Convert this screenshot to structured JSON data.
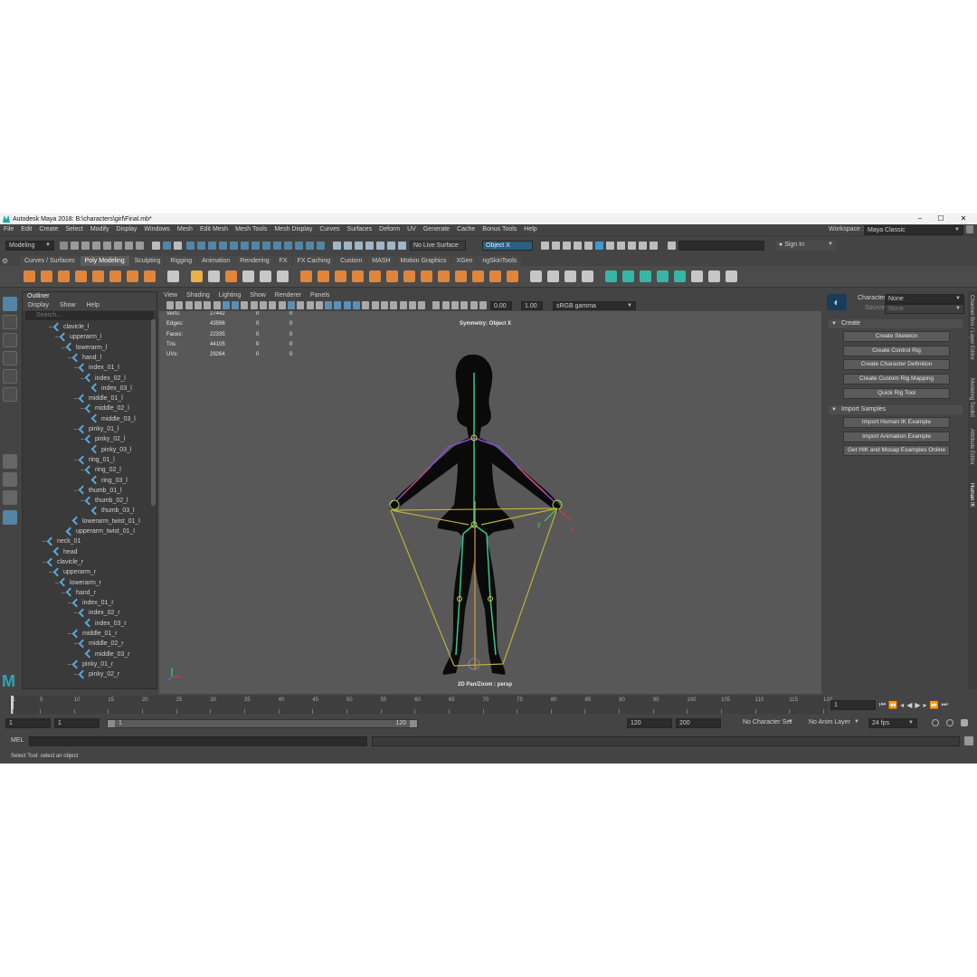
{
  "window": {
    "title": "Autodesk Maya 2018: B:\\characters\\girl\\Final.mb*",
    "minimize": "–",
    "maximize": "☐",
    "close": "✕"
  },
  "menubar": [
    "File",
    "Edit",
    "Create",
    "Select",
    "Modify",
    "Display",
    "Windows",
    "Mesh",
    "Edit Mesh",
    "Mesh Tools",
    "Mesh Display",
    "Curves",
    "Surfaces",
    "Deform",
    "UV",
    "Generate",
    "Cache",
    "Bonus Tools",
    "Help"
  ],
  "workspace": {
    "label": "Workspace :",
    "value": "Maya Classic"
  },
  "statusline": {
    "mode": "Modeling",
    "live_surface": "No Live Surface",
    "symmetry": "Object X",
    "sign_in": "Sign In"
  },
  "shelf_tabs": [
    "Curves / Surfaces",
    "Poly Modeling",
    "Sculpting",
    "Rigging",
    "Animation",
    "Rendering",
    "FX",
    "FX Caching",
    "Custom",
    "MASH",
    "Motion Graphics",
    "XGen",
    "ngSkinTools"
  ],
  "shelf_active": "Poly Modeling",
  "outliner": {
    "title": "Outliner",
    "menus": [
      "Display",
      "Show",
      "Help"
    ],
    "search_placeholder": "Search...",
    "items": [
      {
        "label": "clavicle_l",
        "depth": 4,
        "exp": "–"
      },
      {
        "label": "upperarm_l",
        "depth": 5,
        "exp": "–"
      },
      {
        "label": "lowerarm_l",
        "depth": 6,
        "exp": "–"
      },
      {
        "label": "hand_l",
        "depth": 7,
        "exp": "–"
      },
      {
        "label": "index_01_l",
        "depth": 8,
        "exp": "–"
      },
      {
        "label": "index_02_l",
        "depth": 9,
        "exp": "–"
      },
      {
        "label": "index_03_l",
        "depth": 10,
        "exp": ""
      },
      {
        "label": "middle_01_l",
        "depth": 8,
        "exp": "–"
      },
      {
        "label": "middle_02_l",
        "depth": 9,
        "exp": "–"
      },
      {
        "label": "middle_03_l",
        "depth": 10,
        "exp": ""
      },
      {
        "label": "pinky_01_l",
        "depth": 8,
        "exp": "–"
      },
      {
        "label": "pinky_02_l",
        "depth": 9,
        "exp": "–"
      },
      {
        "label": "pinky_03_l",
        "depth": 10,
        "exp": ""
      },
      {
        "label": "ring_01_l",
        "depth": 8,
        "exp": "–"
      },
      {
        "label": "ring_02_l",
        "depth": 9,
        "exp": "–"
      },
      {
        "label": "ring_03_l",
        "depth": 10,
        "exp": ""
      },
      {
        "label": "thumb_01_l",
        "depth": 8,
        "exp": "–"
      },
      {
        "label": "thumb_02_l",
        "depth": 9,
        "exp": "–"
      },
      {
        "label": "thumb_03_l",
        "depth": 10,
        "exp": ""
      },
      {
        "label": "lowerarm_twist_01_l",
        "depth": 7,
        "exp": ""
      },
      {
        "label": "upperarm_twist_01_l",
        "depth": 6,
        "exp": ""
      },
      {
        "label": "neck_01",
        "depth": 3,
        "exp": "–"
      },
      {
        "label": "head",
        "depth": 4,
        "exp": ""
      },
      {
        "label": "clavicle_r",
        "depth": 3,
        "exp": "–"
      },
      {
        "label": "upperarm_r",
        "depth": 4,
        "exp": "–"
      },
      {
        "label": "lowerarm_r",
        "depth": 5,
        "exp": "–"
      },
      {
        "label": "hand_r",
        "depth": 6,
        "exp": "–"
      },
      {
        "label": "index_01_r",
        "depth": 7,
        "exp": "–"
      },
      {
        "label": "index_02_r",
        "depth": 8,
        "exp": "–"
      },
      {
        "label": "index_03_r",
        "depth": 9,
        "exp": ""
      },
      {
        "label": "middle_01_r",
        "depth": 7,
        "exp": "–"
      },
      {
        "label": "middle_02_r",
        "depth": 8,
        "exp": "–"
      },
      {
        "label": "middle_03_r",
        "depth": 9,
        "exp": ""
      },
      {
        "label": "pinky_01_r",
        "depth": 7,
        "exp": "–"
      },
      {
        "label": "pinky_02_r",
        "depth": 8,
        "exp": "–"
      }
    ]
  },
  "viewport": {
    "menus": [
      "View",
      "Shading",
      "Lighting",
      "Show",
      "Renderer",
      "Panels"
    ],
    "exposure": "0.00",
    "gamma": "1.00",
    "colorspace": "sRGB gamma",
    "symmetry_label": "Symmetry: Object X",
    "camera_label": "2D Pan/Zoom : persp",
    "stats": [
      {
        "name": "Verts:",
        "v1": "27442",
        "v2": "0",
        "v3": "0"
      },
      {
        "name": "Edges:",
        "v1": "43596",
        "v2": "0",
        "v3": "0"
      },
      {
        "name": "Faces:",
        "v1": "22335",
        "v2": "0",
        "v3": "0"
      },
      {
        "name": "Tris:",
        "v1": "44105",
        "v2": "0",
        "v3": "0"
      },
      {
        "name": "UVs:",
        "v1": "29264",
        "v2": "0",
        "v3": "0"
      }
    ],
    "axis_y": "y",
    "axis_x": "x"
  },
  "humanik": {
    "character_label": "Character:",
    "character_value": "None",
    "source_label": "Source:",
    "source_value": "None",
    "create_section": "Create",
    "create_buttons": [
      "Create Skeleton",
      "Create Control Rig",
      "Create Character Definition",
      "Create Custom Rig Mapping",
      "Quick Rig Tool"
    ],
    "import_section": "Import Samples",
    "import_buttons": [
      "Import Human IK Example",
      "Import Animation Example",
      "Get HIK and Mocap Examples Online"
    ]
  },
  "side_tabs": [
    "Channel Box / Layer Editor",
    "Modeling Toolkit",
    "Attribute Editor",
    "Human IK"
  ],
  "timeline": {
    "ticks": [
      "1",
      "5",
      "10",
      "15",
      "20",
      "25",
      "30",
      "35",
      "40",
      "45",
      "50",
      "55",
      "60",
      "65",
      "70",
      "75",
      "80",
      "85",
      "90",
      "95",
      "100",
      "105",
      "110",
      "115",
      "120"
    ],
    "current_frame": "1"
  },
  "range": {
    "start": "1",
    "anim_start": "1",
    "range_start_label": "1",
    "range_end_label": "120",
    "end": "120",
    "anim_end": "200",
    "character_set": "No Character Set",
    "anim_layer": "No Anim Layer",
    "fps": "24 fps"
  },
  "command": {
    "lang": "MEL"
  },
  "help_line": "Select Tool: select an object",
  "colors": {
    "accent": "#5285a6",
    "shelf_orange": "#e0853a",
    "shelf_teal": "#35b6a6",
    "viewport_bg": "#585858"
  }
}
